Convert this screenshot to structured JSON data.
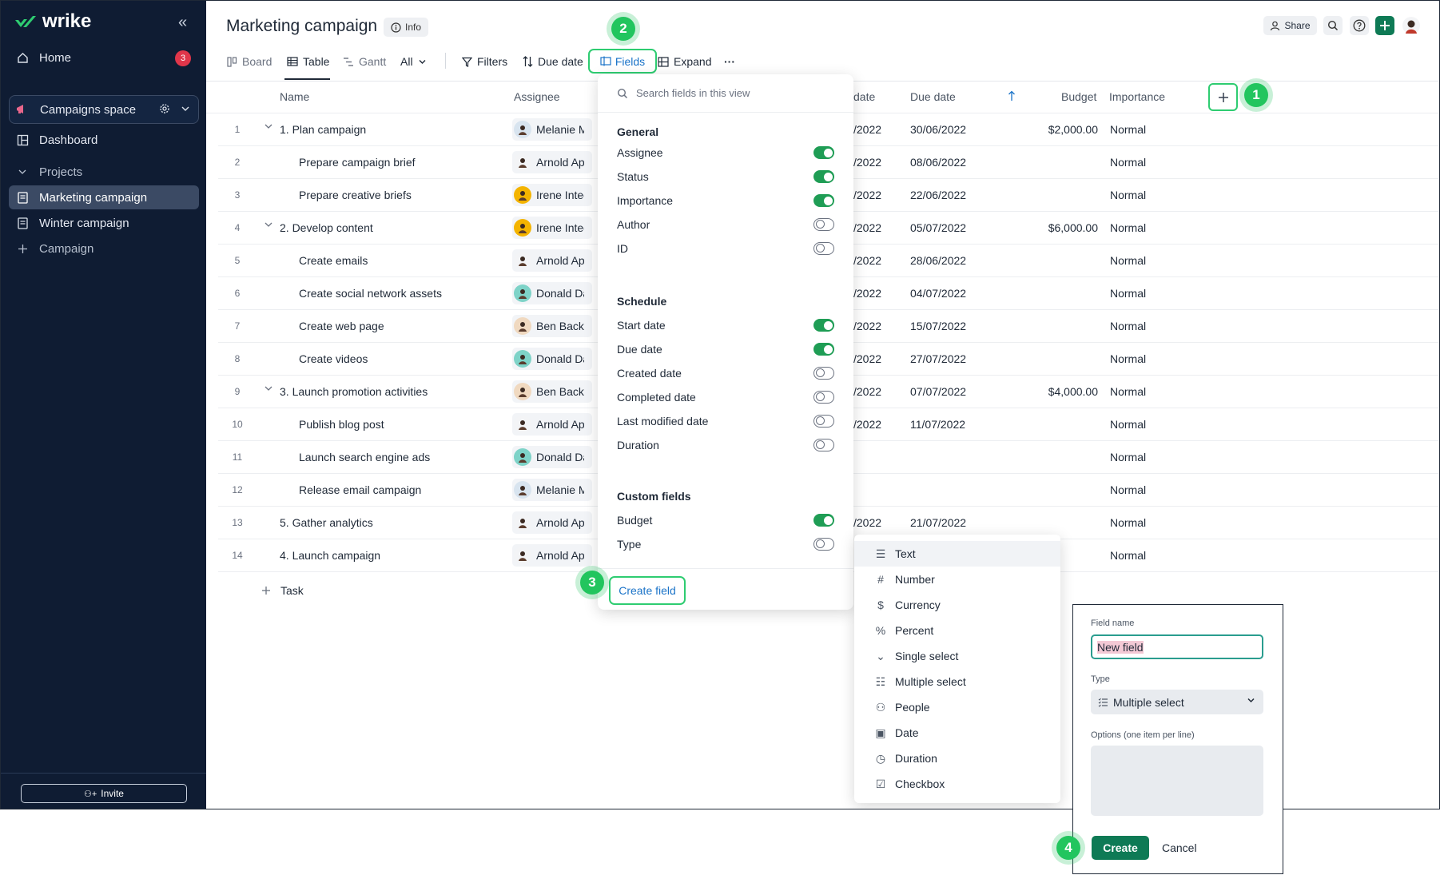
{
  "sidebar": {
    "logo": "wrike",
    "home": {
      "label": "Home",
      "badge": "3"
    },
    "space": {
      "label": "Campaigns space"
    },
    "dashboard": "Dashboard",
    "projects": "Projects",
    "items": [
      "Marketing campaign",
      "Winter campaign",
      "Campaign"
    ],
    "invite": "Invite"
  },
  "header": {
    "title": "Marketing campaign",
    "info": "Info",
    "share": "Share"
  },
  "toolbar": {
    "board": "Board",
    "table": "Table",
    "gantt": "Gantt",
    "all": "All",
    "filters": "Filters",
    "due_date": "Due date",
    "fields": "Fields",
    "expand": "Expand",
    "more": "···"
  },
  "table": {
    "columns": {
      "name": "Name",
      "assignee": "Assignee",
      "start_date": "date",
      "due_date": "Due date",
      "budget": "Budget",
      "importance": "Importance"
    },
    "rows": [
      {
        "num": "1",
        "name": "1. Plan campaign",
        "assignee": "Melanie Mi",
        "start": "/2022",
        "due": "30/06/2022",
        "budget": "$2,000.00",
        "importance": "Normal"
      },
      {
        "num": "2",
        "name": "Prepare campaign brief",
        "assignee": "Arnold App",
        "start": "/2022",
        "due": "08/06/2022",
        "budget": "",
        "importance": "Normal"
      },
      {
        "num": "3",
        "name": "Prepare creative briefs",
        "assignee": "Irene Integ",
        "start": "/2022",
        "due": "22/06/2022",
        "budget": "",
        "importance": "Normal"
      },
      {
        "num": "4",
        "name": "2. Develop content",
        "assignee": "Irene Integ",
        "start": "/2022",
        "due": "05/07/2022",
        "budget": "$6,000.00",
        "importance": "Normal"
      },
      {
        "num": "5",
        "name": "Create emails",
        "assignee": "Arnold App",
        "start": "/2022",
        "due": "28/06/2022",
        "budget": "",
        "importance": "Normal"
      },
      {
        "num": "6",
        "name": "Create social network assets",
        "assignee": "Donald Das",
        "start": "/2022",
        "due": "04/07/2022",
        "budget": "",
        "importance": "Normal"
      },
      {
        "num": "7",
        "name": "Create web page",
        "assignee": "Ben Backlo",
        "start": "/2022",
        "due": "15/07/2022",
        "budget": "",
        "importance": "Normal"
      },
      {
        "num": "8",
        "name": "Create videos",
        "assignee": "Donald Das",
        "start": "/2022",
        "due": "27/07/2022",
        "budget": "",
        "importance": "Normal"
      },
      {
        "num": "9",
        "name": "3. Launch promotion activities",
        "assignee": "Ben Backlo",
        "start": "/2022",
        "due": "07/07/2022",
        "budget": "$4,000.00",
        "importance": "Normal"
      },
      {
        "num": "10",
        "name": "Publish blog post",
        "assignee": "Arnold App",
        "start": "/2022",
        "due": "11/07/2022",
        "budget": "",
        "importance": "Normal"
      },
      {
        "num": "11",
        "name": "Launch search engine ads",
        "assignee": "Donald Das",
        "start": "",
        "due": "",
        "budget": "",
        "importance": "Normal"
      },
      {
        "num": "12",
        "name": "Release email campaign",
        "assignee": "Melanie Mi",
        "start": "",
        "due": "",
        "budget": "",
        "importance": "Normal"
      },
      {
        "num": "13",
        "name": "5. Gather analytics",
        "assignee": "Arnold App",
        "start": "/2022",
        "due": "21/07/2022",
        "budget": "",
        "importance": "Normal"
      },
      {
        "num": "14",
        "name": "4. Launch campaign",
        "assignee": "Arnold App",
        "start": "",
        "due": "",
        "budget": "",
        "importance": "Normal"
      }
    ],
    "add_task": "Task"
  },
  "fields_panel": {
    "search_placeholder": "Search fields in this view",
    "general": "General",
    "general_items": [
      {
        "label": "Assignee",
        "on": true
      },
      {
        "label": "Status",
        "on": true
      },
      {
        "label": "Importance",
        "on": true
      },
      {
        "label": "Author",
        "on": false
      },
      {
        "label": "ID",
        "on": false
      }
    ],
    "schedule": "Schedule",
    "schedule_items": [
      {
        "label": "Start date",
        "on": true
      },
      {
        "label": "Due date",
        "on": true
      },
      {
        "label": "Created date",
        "on": false
      },
      {
        "label": "Completed date",
        "on": false
      },
      {
        "label": "Last modified date",
        "on": false
      },
      {
        "label": "Duration",
        "on": false
      }
    ],
    "custom": "Custom fields",
    "custom_items": [
      {
        "label": "Budget",
        "on": true
      },
      {
        "label": "Type",
        "on": false
      }
    ],
    "create_field": "Create field"
  },
  "type_menu": {
    "items": [
      {
        "label": "Text",
        "icon": "text-icon",
        "glyph": "☰"
      },
      {
        "label": "Number",
        "icon": "hash-icon",
        "glyph": "#"
      },
      {
        "label": "Currency",
        "icon": "currency-icon",
        "glyph": "$"
      },
      {
        "label": "Percent",
        "icon": "percent-icon",
        "glyph": "%"
      },
      {
        "label": "Single select",
        "icon": "single-select-icon",
        "glyph": "⌄"
      },
      {
        "label": "Multiple select",
        "icon": "multiple-select-icon",
        "glyph": "☷"
      },
      {
        "label": "People",
        "icon": "person-icon",
        "glyph": "⚇"
      },
      {
        "label": "Date",
        "icon": "calendar-icon",
        "glyph": "▣"
      },
      {
        "label": "Duration",
        "icon": "clock-icon",
        "glyph": "◷"
      },
      {
        "label": "Checkbox",
        "icon": "checkbox-icon",
        "glyph": "☑"
      }
    ]
  },
  "new_field": {
    "name_label": "Field name",
    "name_value": "New field",
    "type_label": "Type",
    "type_value": "Multiple select",
    "options_label": "Options (one item per line)",
    "create": "Create",
    "cancel": "Cancel"
  },
  "steps": [
    "1",
    "2",
    "3",
    "4"
  ],
  "colors": {
    "sidebar": "#0f1c33",
    "accent": "#0e7a55",
    "highlight": "#2ecc71",
    "toggle_on": "#1f9d55",
    "link": "#1a73c8"
  }
}
